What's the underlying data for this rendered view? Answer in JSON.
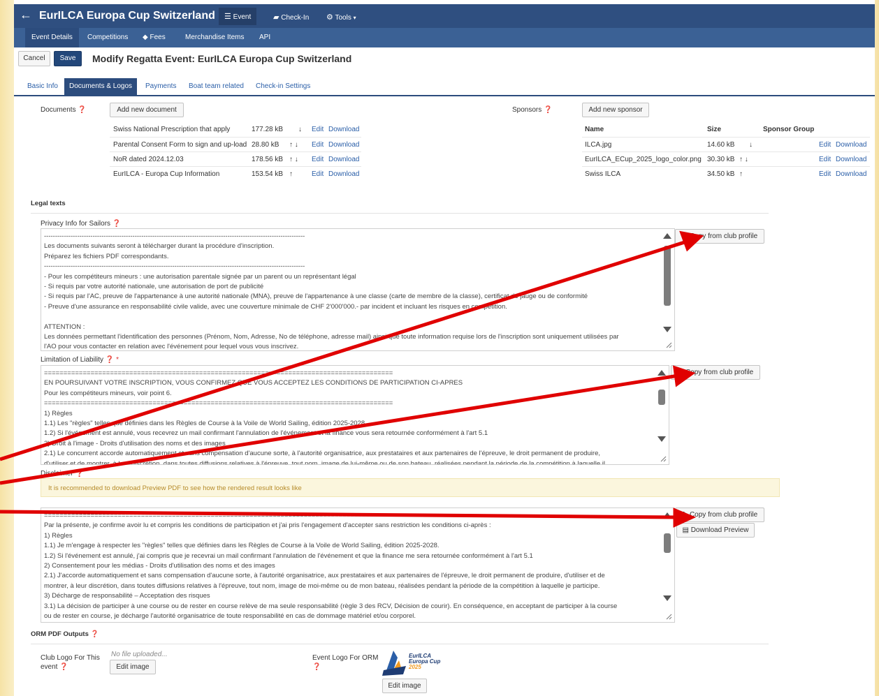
{
  "header": {
    "back_icon": "arrow-left-icon",
    "title": "EurILCA Europa Cup Switzerland",
    "nav": [
      {
        "label": "Event",
        "icon": "list-icon"
      },
      {
        "label": "Check-In",
        "icon": "book-icon"
      },
      {
        "label": "Tools",
        "icon": "gear-icon"
      }
    ]
  },
  "subnav": [
    "Event Details",
    "Competitions",
    "Fees",
    "Merchandise Items",
    "API"
  ],
  "toolbar": {
    "cancel": "Cancel",
    "save": "Save",
    "title": "Modify Regatta Event: EurILCA Europa Cup Switzerland"
  },
  "tabs": [
    "Basic Info",
    "Documents & Logos",
    "Payments",
    "Boat team related",
    "Check-in Settings"
  ],
  "documents": {
    "label": "Documents",
    "add": "Add new document",
    "rows": [
      {
        "name": "Swiss National Prescription that apply",
        "size": "177.28 kB",
        "arrows": "↓"
      },
      {
        "name": "Parental Consent Form to sign and up-load",
        "size": "28.80 kB",
        "arrows": "↑ ↓"
      },
      {
        "name": "NoR dated 2024.12.03",
        "size": "178.56 kB",
        "arrows": "↑ ↓"
      },
      {
        "name": "EurILCA - Europa Cup Information",
        "size": "153.54 kB",
        "arrows": "↑"
      }
    ],
    "edit": "Edit",
    "download": "Download"
  },
  "sponsors": {
    "label": "Sponsors",
    "add": "Add new sponsor",
    "columns": [
      "Name",
      "Size",
      "Sponsor Group"
    ],
    "rows": [
      {
        "name": "ILCA.jpg",
        "size": "14.60 kB",
        "arrows": "↓"
      },
      {
        "name": "EurILCA_ECup_2025_logo_color.png",
        "size": "30.30 kB",
        "arrows": "↑ ↓"
      },
      {
        "name": "Swiss ILCA",
        "size": "34.50 kB",
        "arrows": "↑"
      }
    ],
    "edit": "Edit",
    "download": "Download"
  },
  "legal": {
    "heading": "Legal texts",
    "privacy": {
      "label": "Privacy Info for Sailors",
      "copy": "Copy from club profile",
      "lines": [
        "----------------------------------------------------------------------------------------------------------------------",
        "Les documents suivants seront à télécharger durant la procédure d'inscription.",
        "Préparez les fichiers PDF correspondants.",
        "----------------------------------------------------------------------------------------------------------------------",
        "- Pour les compétiteurs mineurs : une autorisation parentale signée par un parent ou un représentant légal",
        "- Si requis par votre autorité nationale, une autorisation de port de publicité",
        "- Si requis par l'AC, preuve de l'appartenance à une autorité nationale (MNA), preuve de l'appartenance à une classe (carte de membre de la classe), certificat de jauge ou de conformité",
        "- Preuve d'une assurance en responsabilité civile valide, avec une couverture minimale de CHF 2'000'000.- par incident et incluant les risques en compétition.",
        "",
        "ATTENTION :",
        "Les données permettant l'identification des personnes (Prénom, Nom, Adresse, No de téléphone, adresse mail) ainsi que toute information requise lors de l'inscription sont uniquement utilisées par",
        "l'AO pour vous contacter en relation avec l'événement pour lequel vous vous inscrivez."
      ]
    },
    "liability": {
      "label": "Limitation of Liability",
      "required": "*",
      "copy": "Copy from club profile",
      "lines": [
        "==========================================================================================",
        "EN POURSUIVANT VOTRE INSCRIPTION, VOUS CONFIRMEZ QUE VOUS ACCEPTEZ LES CONDITIONS DE PARTICIPATION CI-APRES",
        "Pour les compétiteurs mineurs, voir point 6.",
        "==========================================================================================",
        "1) Règles",
        "   1.1) Les \"règles\" telles que définies dans les Règles de Course à la Voile de World Sailing, édition 2025-2028.",
        "   1.2) Si l'événement est annulé, vous recevrez un mail confirmant l'annulation de l'événement et la finance vous sera retournée conformément à l'art 5.1",
        "2) Droit à l'image  -  Droits d'utilisation des noms et des images",
        "   2.1) Le concurrent accorde automatiquement et sans compensation d'aucune sorte, à l'autorité organisatrice, aux prestataires et aux partenaires de l'épreuve, le droit permanent de produire,",
        "d'utiliser et de montrer, à leur discrétion, dans toutes diffusions relatives à l'épreuve, tout nom, image de lui-même ou de son bateau, réalisées pendant la période de la compétition à laquelle il"
      ]
    },
    "disclaimer": {
      "label": "Disclaimer",
      "alert": "It is recommended to download Preview PDF to see how the rendered result looks like",
      "copy": "Copy from club profile",
      "preview": "Download Preview",
      "lines": [
        "==========================================================================================",
        "Par la présente, je confirme avoir lu et compris les conditions de participation et j'ai pris l'engagement d'accepter sans restriction les conditions ci-après :",
        "1) Règles",
        "   1.1) Je m'engage à respecter les \"règles\" telles que définies dans les Règles de Course à la Voile de World Sailing, édition 2025-2028.",
        "   1.2) Si l'événement est annulé, j'ai compris que je recevrai un mail confirmant l'annulation de l'événement et que la finance me sera retournée conformément à l'art 5.1",
        "2) Consentement pour les médias - Droits d'utilisation des noms et des images",
        "   2.1) J'accorde automatiquement et sans compensation d'aucune sorte, à l'autorité organisatrice, aux prestataires et aux partenaires de l'épreuve, le droit permanent de produire, d'utiliser et de",
        "montrer, à leur discrétion, dans toutes diffusions relatives à l'épreuve, tout nom, image de moi-même ou de mon bateau, réalisées pendant la période de la compétition à laquelle je participe.",
        "3) Décharge de responsabilité – Acceptation des risques",
        "   3.1) La décision de participer à une course ou de rester en course relève de ma seule responsabilité (règle 3 des RCV, Décision de courir). En conséquence, en acceptant de participer à la course",
        "ou de rester en course, je décharge l'autorité organisatrice de toute responsabilité en cas de dommage matériel et/ou corporel."
      ]
    }
  },
  "orm": {
    "heading": "ORM PDF Outputs",
    "club_logo_label_1": "Club Logo For This",
    "club_logo_label_2": "event",
    "no_file": "No file uploaded...",
    "edit_image": "Edit image",
    "event_logo_label": "Event Logo For ORM",
    "logo_text_1": "EurILCA",
    "logo_text_2": "Europa Cup",
    "logo_text_3": "2025"
  },
  "colors": {
    "navbar": "#2f4f80",
    "subnav": "#3b6195",
    "accent": "#2c4c7d",
    "link": "#2b5fa8",
    "annotation_arrow": "#e00000"
  }
}
